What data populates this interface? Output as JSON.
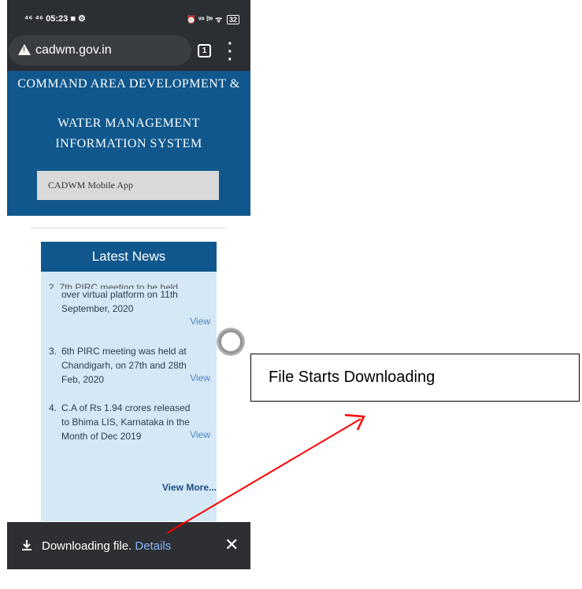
{
  "status_bar": {
    "left": "⁴⁶ ⁴⁶ 05:23 ■ ⚙",
    "right": "⏰ ᵛᵒ ᶩᵗᵉ ᯤ",
    "battery": "32"
  },
  "browser": {
    "url": "cadwm.gov.in",
    "tab_count": "1"
  },
  "header": {
    "line1": "COMMAND AREA DEVELOPMENT &",
    "line2": "WATER MANAGEMENT",
    "line3": "INFORMATION SYSTEM",
    "app_button": "CADWM Mobile App"
  },
  "news": {
    "title": "Latest News",
    "cut_text": "2.  7th PIRC meeting to be held",
    "items": [
      {
        "num": "",
        "text": "over virtual platform on 11th September, 2020",
        "view": "View"
      },
      {
        "num": "3.",
        "text": "6th PIRC meeting was held at Chandigarh, on 27th and 28th Feb, 2020",
        "view": "View"
      },
      {
        "num": "4.",
        "text": "C.A of Rs 1.94 crores released to Bhima LIS, Karnataka in the Month of Dec 2019",
        "view": "View"
      }
    ],
    "view_more": "View More..."
  },
  "download_bar": {
    "text": "Downloading file.",
    "link": "Details"
  },
  "annotation": {
    "label": "File Starts Downloading",
    "arrow_color": "#ff0000"
  }
}
